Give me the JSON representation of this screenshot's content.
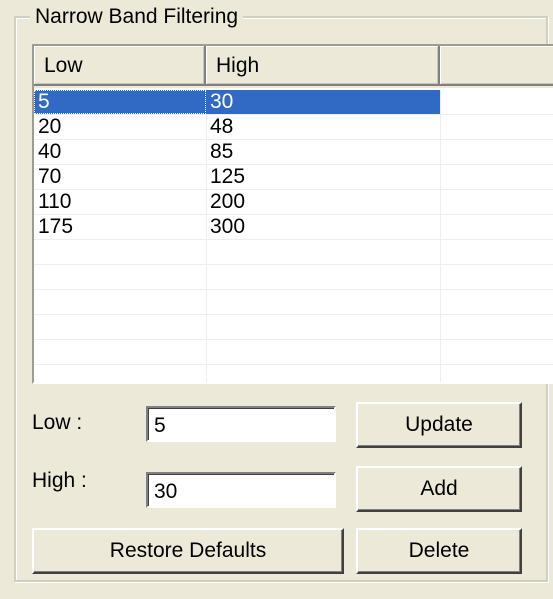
{
  "group": {
    "title": "Narrow Band Filtering"
  },
  "list": {
    "columns": [
      "Low",
      "High",
      ""
    ],
    "rows": [
      {
        "low": "5",
        "high": "30",
        "selected": true
      },
      {
        "low": "20",
        "high": "48",
        "selected": false
      },
      {
        "low": "40",
        "high": "85",
        "selected": false
      },
      {
        "low": "70",
        "high": "125",
        "selected": false
      },
      {
        "low": "110",
        "high": "200",
        "selected": false
      },
      {
        "low": "175",
        "high": "300",
        "selected": false
      }
    ]
  },
  "form": {
    "low_label": "Low :",
    "low_value": "5",
    "high_label": "High :",
    "high_value": "30"
  },
  "buttons": {
    "update": "Update",
    "add": "Add",
    "restore": "Restore Defaults",
    "delete": "Delete"
  },
  "colors": {
    "selection": "#316ac5",
    "background": "#ece9d8"
  }
}
